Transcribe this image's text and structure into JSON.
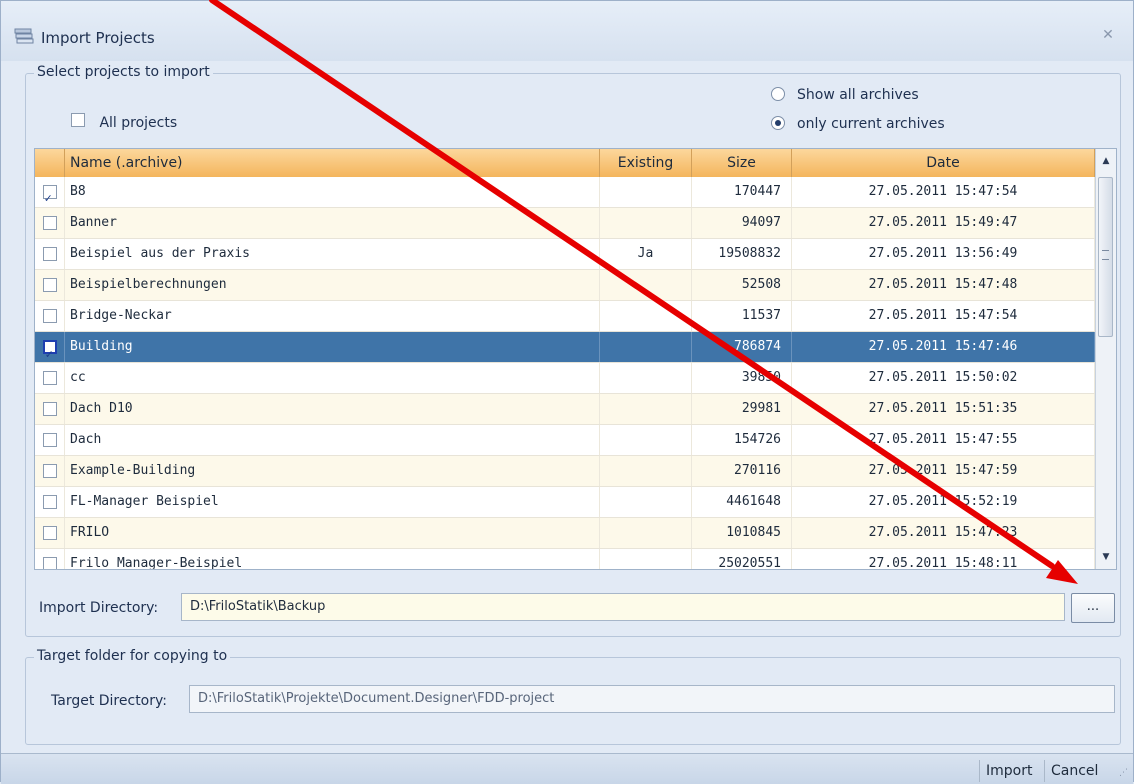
{
  "window": {
    "title": "Import Projects",
    "close_icon": "close-icon"
  },
  "select_group": {
    "legend": "Select projects to import",
    "all_projects_label": "All projects",
    "all_projects_checked": false,
    "radio_show_all": "Show all archives",
    "radio_only_current": "only current archives",
    "selected_radio": "only current archives"
  },
  "grid": {
    "columns": [
      "Name (.archive)",
      "Existing",
      "Size",
      "Date"
    ],
    "rows": [
      {
        "checked": true,
        "name": "B8",
        "existing": "",
        "size": "170447",
        "date": "27.05.2011 15:47:54"
      },
      {
        "checked": false,
        "name": "Banner",
        "existing": "",
        "size": "94097",
        "date": "27.05.2011 15:49:47"
      },
      {
        "checked": false,
        "name": "Beispiel aus der Praxis",
        "existing": "Ja",
        "size": "19508832",
        "date": "27.05.2011 13:56:49"
      },
      {
        "checked": false,
        "name": "Beispielberechnungen",
        "existing": "",
        "size": "52508",
        "date": "27.05.2011 15:47:48"
      },
      {
        "checked": false,
        "name": "Bridge-Neckar",
        "existing": "",
        "size": "11537",
        "date": "27.05.2011 15:47:54"
      },
      {
        "checked": true,
        "name": "Building",
        "existing": "",
        "size": "786874",
        "date": "27.05.2011 15:47:46",
        "selected": true
      },
      {
        "checked": false,
        "name": "cc",
        "existing": "",
        "size": "39850",
        "date": "27.05.2011 15:50:02"
      },
      {
        "checked": false,
        "name": "Dach D10",
        "existing": "",
        "size": "29981",
        "date": "27.05.2011 15:51:35"
      },
      {
        "checked": false,
        "name": "Dach",
        "existing": "",
        "size": "154726",
        "date": "27.05.2011 15:47:55"
      },
      {
        "checked": false,
        "name": "Example-Building",
        "existing": "",
        "size": "270116",
        "date": "27.05.2011 15:47:59"
      },
      {
        "checked": false,
        "name": "FL-Manager Beispiel",
        "existing": "",
        "size": "4461648",
        "date": "27.05.2011 15:52:19"
      },
      {
        "checked": false,
        "name": "FRILO",
        "existing": "",
        "size": "1010845",
        "date": "27.05.2011 15:47:23"
      },
      {
        "checked": false,
        "name": "Frilo Manager-Beispiel",
        "existing": "",
        "size": "25020551",
        "date": "27.05.2011 15:48:11"
      }
    ]
  },
  "import_dir": {
    "label": "Import Directory:",
    "value": "D:\\FriloStatik\\Backup",
    "browse_label": "..."
  },
  "target_group": {
    "legend": "Target folder for copying to",
    "label": "Target Directory:",
    "value": "D:\\FriloStatik\\Projekte\\Document.Designer\\FDD-project"
  },
  "footer": {
    "import_label": "Import",
    "cancel_label": "Cancel"
  },
  "colors": {
    "header_orange": "#f4b55c",
    "selection_blue": "#3f74a8",
    "annotation_red": "#e60000"
  }
}
